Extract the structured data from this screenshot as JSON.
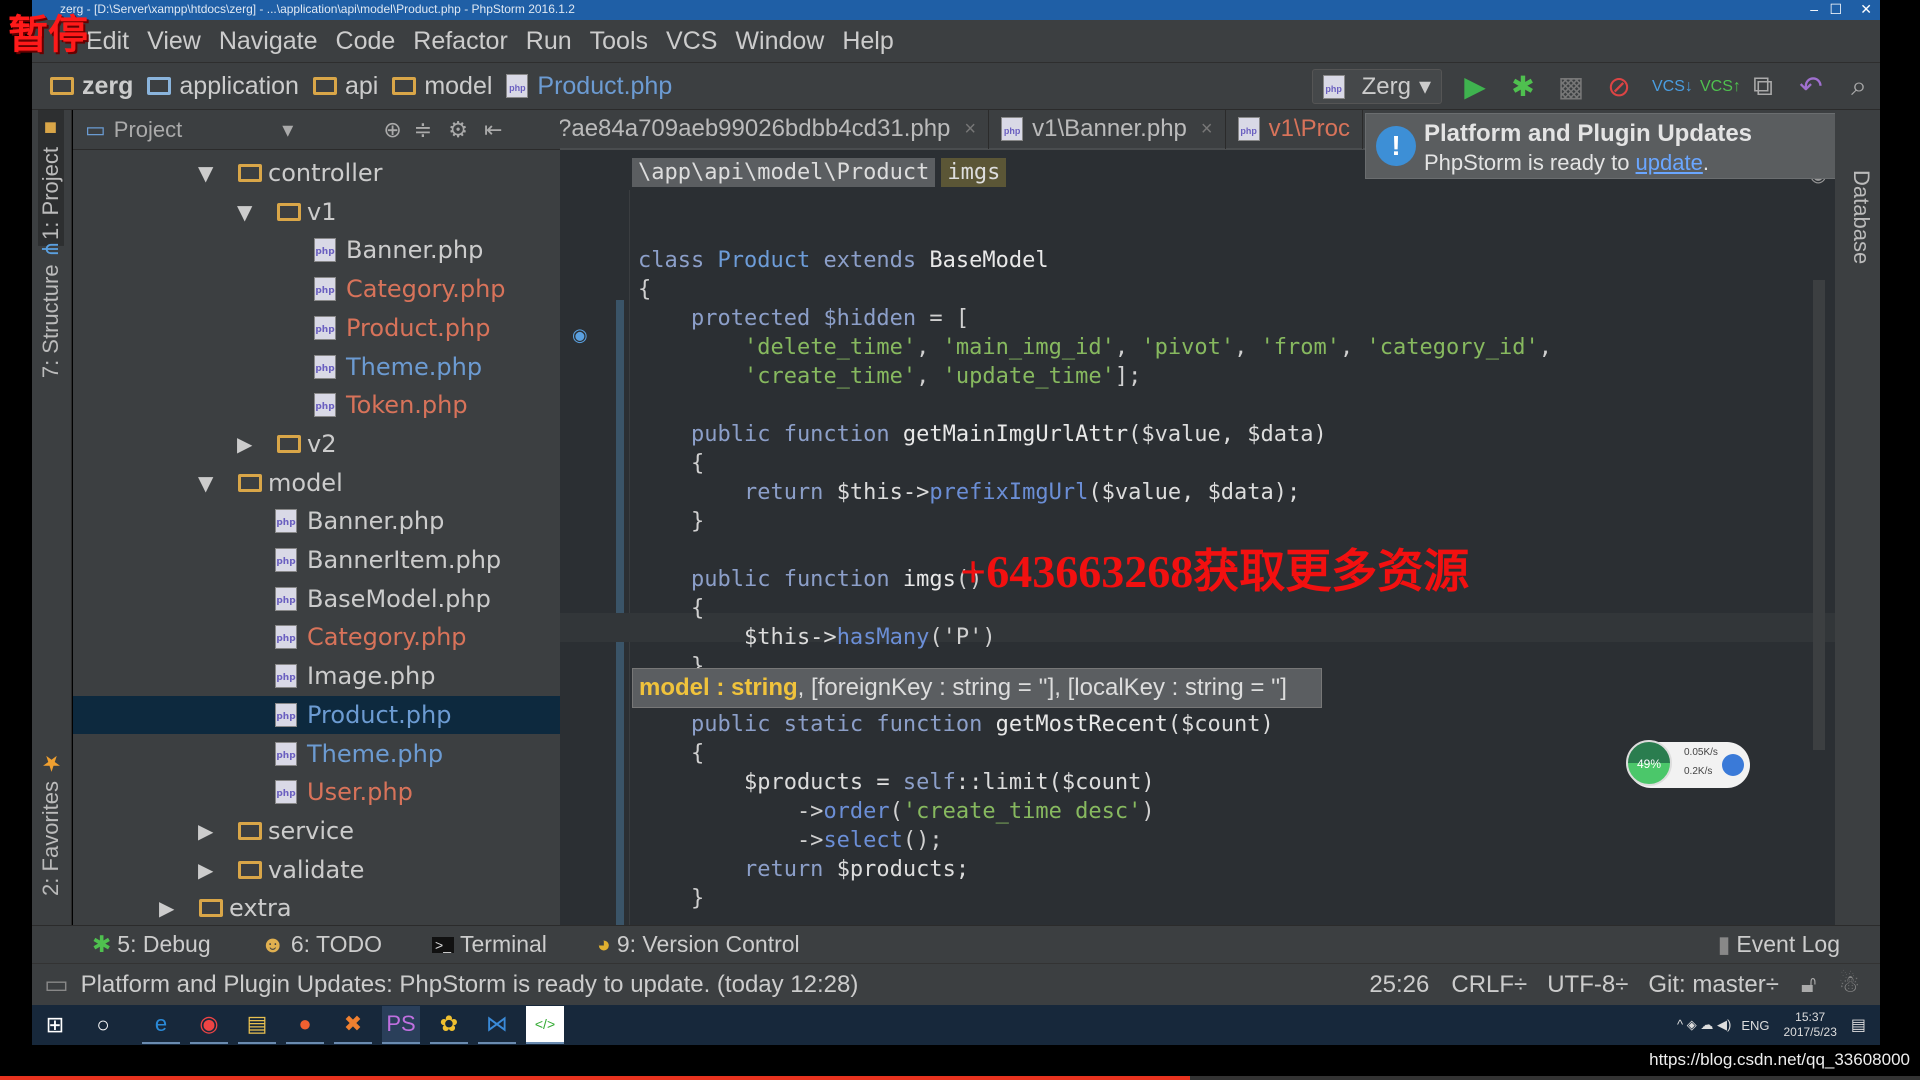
{
  "overlay": {
    "pause_label": "暂停",
    "watermark": "+643663268获取更多资源",
    "source_url": "https://blog.csdn.net/qq_33608000",
    "playback_progress_percent": 62
  },
  "window": {
    "title": "zerg - [D:\\Server\\xampp\\htdocs\\zerg] - ...\\application\\api\\model\\Product.php - PhpStorm 2016.1.2",
    "minimize": "–",
    "maximize": "☐",
    "close": "✕"
  },
  "menu": [
    "Edit",
    "View",
    "Navigate",
    "Code",
    "Refactor",
    "Run",
    "Tools",
    "VCS",
    "Window",
    "Help"
  ],
  "navbar": {
    "crumbs": [
      "zerg",
      "application",
      "api",
      "model",
      "Product.php"
    ],
    "run_config": "Zerg"
  },
  "tool_windows": {
    "project": "1: Project",
    "structure": "7: Structure",
    "favorites": "2: Favorites",
    "database": "Database"
  },
  "project_panel": {
    "title": "Project",
    "tree": [
      {
        "label": "controller",
        "type": "folder",
        "depth": 0,
        "expanded": true,
        "color": "#cccccc"
      },
      {
        "label": "v1",
        "type": "folder",
        "depth": 1,
        "expanded": true,
        "color": "#cccccc"
      },
      {
        "label": "Banner.php",
        "type": "file",
        "depth": 2,
        "color": "#cccccc"
      },
      {
        "label": "Category.php",
        "type": "file",
        "depth": 2,
        "color": "#d8735a"
      },
      {
        "label": "Product.php",
        "type": "file",
        "depth": 2,
        "color": "#d8735a"
      },
      {
        "label": "Theme.php",
        "type": "file",
        "depth": 2,
        "color": "#6c9bd2"
      },
      {
        "label": "Token.php",
        "type": "file",
        "depth": 2,
        "color": "#d8735a"
      },
      {
        "label": "v2",
        "type": "folder",
        "depth": 1,
        "expanded": false,
        "color": "#cccccc"
      },
      {
        "label": "model",
        "type": "folder",
        "depth": 0,
        "expanded": true,
        "color": "#cccccc"
      },
      {
        "label": "Banner.php",
        "type": "file",
        "depth": 1,
        "color": "#cccccc"
      },
      {
        "label": "BannerItem.php",
        "type": "file",
        "depth": 1,
        "color": "#cccccc"
      },
      {
        "label": "BaseModel.php",
        "type": "file",
        "depth": 1,
        "color": "#cccccc"
      },
      {
        "label": "Category.php",
        "type": "file",
        "depth": 1,
        "color": "#d8735a"
      },
      {
        "label": "Image.php",
        "type": "file",
        "depth": 1,
        "color": "#cccccc"
      },
      {
        "label": "Product.php",
        "type": "file",
        "depth": 1,
        "color": "#6c9bd2",
        "selected": true
      },
      {
        "label": "Theme.php",
        "type": "file",
        "depth": 1,
        "color": "#6c9bd2"
      },
      {
        "label": "User.php",
        "type": "file",
        "depth": 1,
        "color": "#d8735a"
      },
      {
        "label": "service",
        "type": "folder",
        "depth": 0,
        "expanded": false,
        "color": "#cccccc"
      },
      {
        "label": "validate",
        "type": "folder",
        "depth": 0,
        "expanded": false,
        "color": "#cccccc"
      },
      {
        "label": "extra",
        "type": "folder",
        "depth": -1,
        "expanded": false,
        "color": "#cccccc"
      }
    ]
  },
  "editor": {
    "tabs": [
      {
        "label": "?ae84a709aeb99026bdbb4cd31.php",
        "close": "×",
        "color": "#bbbbbb"
      },
      {
        "label": "v1\\Banner.php",
        "close": "×",
        "color": "#cccccc"
      },
      {
        "label": "v1\\Proc",
        "close": "",
        "color": "#d8735a"
      }
    ],
    "breadcrumb": {
      "namespace": "\\app\\api\\model\\Product",
      "method": "imgs"
    },
    "code": [
      [
        [
          "class ",
          "kw"
        ],
        [
          "Product ",
          "cls"
        ],
        [
          "extends ",
          "kw"
        ],
        [
          "BaseModel",
          "fn"
        ]
      ],
      [
        [
          "{",
          "plain"
        ]
      ],
      [
        [
          "    protected ",
          "kw"
        ],
        [
          "$hidden",
          "kw"
        ],
        [
          " = [",
          "plain"
        ]
      ],
      [
        [
          "        ",
          "plain"
        ],
        [
          "'delete_time'",
          "str"
        ],
        [
          ", ",
          "plain"
        ],
        [
          "'main_img_id'",
          "str"
        ],
        [
          ", ",
          "plain"
        ],
        [
          "'pivot'",
          "str"
        ],
        [
          ", ",
          "plain"
        ],
        [
          "'from'",
          "str"
        ],
        [
          ", ",
          "plain"
        ],
        [
          "'category_id'",
          "str"
        ],
        [
          ",",
          "plain"
        ]
      ],
      [
        [
          "        ",
          "plain"
        ],
        [
          "'create_time'",
          "str"
        ],
        [
          ", ",
          "plain"
        ],
        [
          "'update_time'",
          "str"
        ],
        [
          "];",
          "plain"
        ]
      ],
      [],
      [
        [
          "    public function ",
          "kw"
        ],
        [
          "getMainImgUrlAttr",
          "fn"
        ],
        [
          "($value, $data)",
          "var"
        ]
      ],
      [
        [
          "    {",
          "plain"
        ]
      ],
      [
        [
          "        return ",
          "kw"
        ],
        [
          "$this->",
          "var"
        ],
        [
          "prefixImgUrl",
          "call"
        ],
        [
          "($value, $data);",
          "var"
        ]
      ],
      [
        [
          "    }",
          "plain"
        ]
      ],
      [],
      [
        [
          "    public function ",
          "kw"
        ],
        [
          "imgs",
          "fn"
        ],
        [
          "()",
          "plain"
        ]
      ],
      [
        [
          "    {",
          "plain"
        ]
      ],
      [
        [
          "        $this->",
          "var"
        ],
        [
          "hasMany",
          "call"
        ],
        [
          "('P')",
          "plain"
        ]
      ],
      [
        [
          "    }",
          "plain"
        ]
      ],
      [],
      [
        [
          "    public static function ",
          "kw"
        ],
        [
          "getMostRecent",
          "fn"
        ],
        [
          "($count)",
          "var"
        ]
      ],
      [
        [
          "    {",
          "plain"
        ]
      ],
      [
        [
          "        $products = ",
          "var"
        ],
        [
          "self",
          "kw"
        ],
        [
          "::limit($count)",
          "var"
        ]
      ],
      [
        [
          "            ->",
          "plain"
        ],
        [
          "order",
          "call"
        ],
        [
          "(",
          "plain"
        ],
        [
          "'create_time desc'",
          "str"
        ],
        [
          ")",
          "plain"
        ]
      ],
      [
        [
          "            ->",
          "plain"
        ],
        [
          "select",
          "call"
        ],
        [
          "();",
          "plain"
        ]
      ],
      [
        [
          "        return ",
          "kw"
        ],
        [
          "$products;",
          "var"
        ]
      ],
      [
        [
          "    }",
          "plain"
        ]
      ]
    ],
    "param_hint": {
      "current": "model : string",
      "rest": ", [foreignKey : string = ''], [localKey : string = '']"
    }
  },
  "notification": {
    "title": "Platform and Plugin Updates",
    "text": "PhpStorm is ready to ",
    "link": "update",
    "end": "."
  },
  "net_widget": {
    "cpu": "49%",
    "up": "0.05K/s",
    "down": "0.2K/s"
  },
  "bottom_tools": [
    {
      "icon": "bug-icon",
      "label": "5: Debug"
    },
    {
      "icon": "todo-icon",
      "label": "6: TODO"
    },
    {
      "icon": "terminal-icon",
      "label": "Terminal"
    },
    {
      "icon": "vcs-icon",
      "label": "9: Version Control"
    }
  ],
  "event_log": "Event Log",
  "status": {
    "message": "Platform and Plugin Updates: PhpStorm is ready to update. (today 12:28)",
    "position": "25:26",
    "line_sep": "CRLF÷",
    "encoding": "UTF-8÷",
    "vcs": "Git: master÷"
  },
  "taskbar": {
    "time": "15:37",
    "date": "2017/5/23",
    "lang": "ENG"
  }
}
